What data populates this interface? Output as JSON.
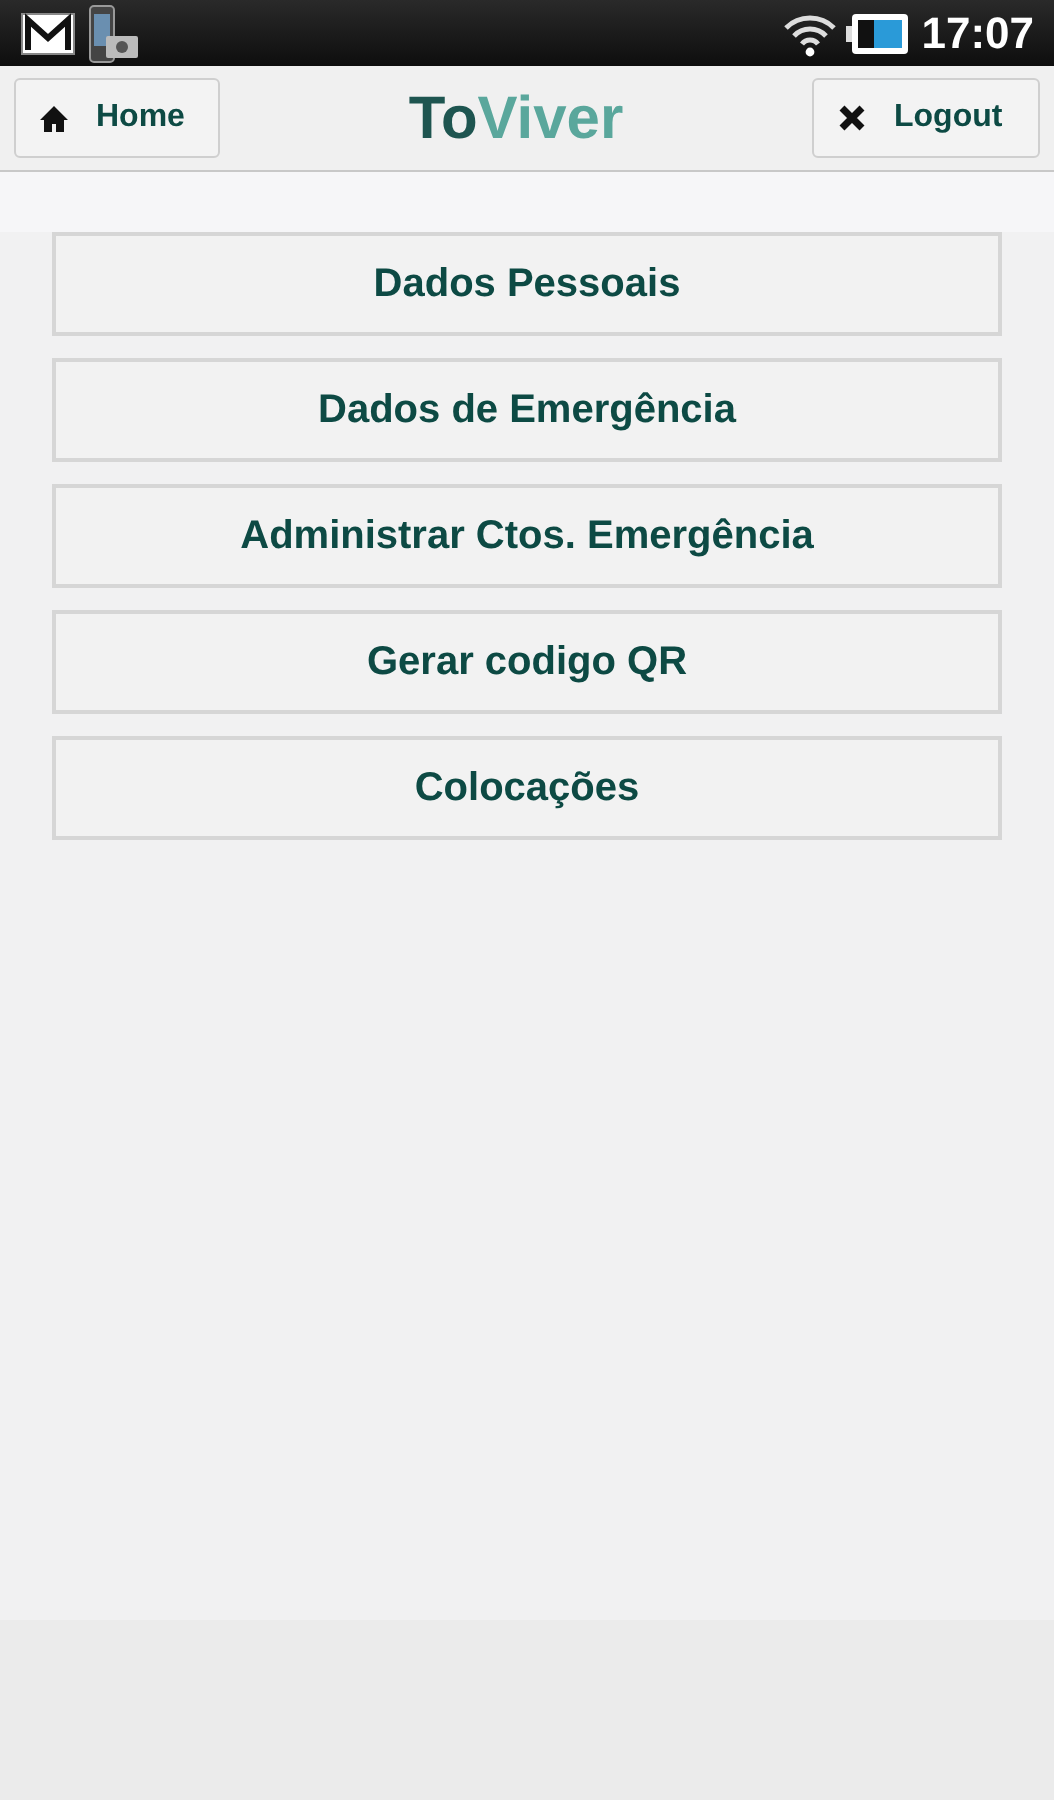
{
  "status_bar": {
    "time": "17:07"
  },
  "header": {
    "home_button": "Home",
    "logo": [
      "To",
      "Viver"
    ],
    "logout_button": "Logout"
  },
  "menu": [
    "Dados Pessoais",
    "Dados de Emergência",
    "Administrar Ctos. Emergência",
    "Gerar codigo QR",
    "Colocações"
  ]
}
